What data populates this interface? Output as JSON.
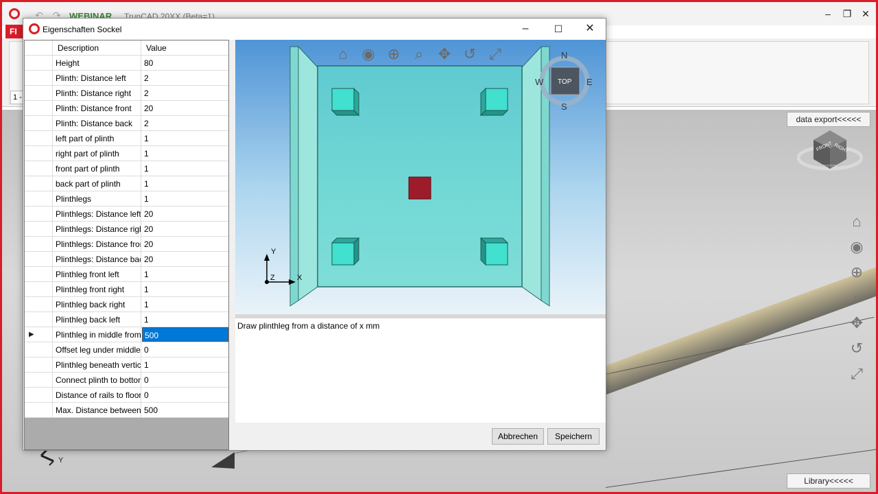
{
  "app": {
    "webinar_label": "WEBINAR",
    "title": "TrunCAD 20XX (Beta=1)",
    "file_tab": "FI",
    "level_value": "1 -"
  },
  "viewport": {
    "data_export_label": "data export<<<<<",
    "library_label": "Library<<<<<",
    "axis_y_label": "Y",
    "cube_labels": {
      "front": "FRONT",
      "right": "RIGHT",
      "bottom": "BOTTOM"
    }
  },
  "dialog": {
    "title": "Eigenschaften Sockel",
    "columns": {
      "description": "Description",
      "value": "Value"
    },
    "rows": [
      {
        "description": "Height",
        "value": "80"
      },
      {
        "description": "Plinth: Distance left",
        "value": "2"
      },
      {
        "description": "Plinth: Distance right",
        "value": "2"
      },
      {
        "description": "Plinth: Distance front",
        "value": "20"
      },
      {
        "description": "Plinth: Distance back",
        "value": "2"
      },
      {
        "description": "left part of plinth",
        "value": "1"
      },
      {
        "description": "right part of plinth",
        "value": "1"
      },
      {
        "description": "front part of plinth",
        "value": "1"
      },
      {
        "description": "back part of plinth",
        "value": "1"
      },
      {
        "description": "Plinthlegs",
        "value": "1"
      },
      {
        "description": "Plinthlegs: Distance left",
        "value": "20"
      },
      {
        "description": "Plinthlegs: Distance right",
        "value": "20"
      },
      {
        "description": "Plinthlegs: Distance front",
        "value": "20"
      },
      {
        "description": "Plinthlegs: Distance back",
        "value": "20"
      },
      {
        "description": "Plinthleg front left",
        "value": "1"
      },
      {
        "description": "Plinthleg front right",
        "value": "1"
      },
      {
        "description": "Plinthleg back right",
        "value": "1"
      },
      {
        "description": "Plinthleg back left",
        "value": "1"
      },
      {
        "description": "Plinthleg in middle from",
        "value": "500"
      },
      {
        "description": "Offset leg under middle...",
        "value": "0"
      },
      {
        "description": "Plinthleg beneath vertical",
        "value": "1"
      },
      {
        "description": "Connect plinth to bottom",
        "value": "0"
      },
      {
        "description": "Distance of rails to floor",
        "value": "0"
      },
      {
        "description": "Max. Distance between...",
        "value": "500"
      }
    ],
    "selected_row": 18,
    "hint_text": "Draw plinthleg from a distance of x mm",
    "cancel_label": "Abbrechen",
    "save_label": "Speichern",
    "compass": {
      "n": "N",
      "s": "S",
      "e": "E",
      "w": "W",
      "center": "TOP"
    },
    "axes": {
      "x": "X",
      "y": "Y",
      "z": "Z"
    }
  },
  "colors": {
    "brand_red": "#d81e28",
    "selection_blue": "#0078d7",
    "part_cyan": "#3fdbcc",
    "middle_leg_red": "#9e1c2a"
  }
}
